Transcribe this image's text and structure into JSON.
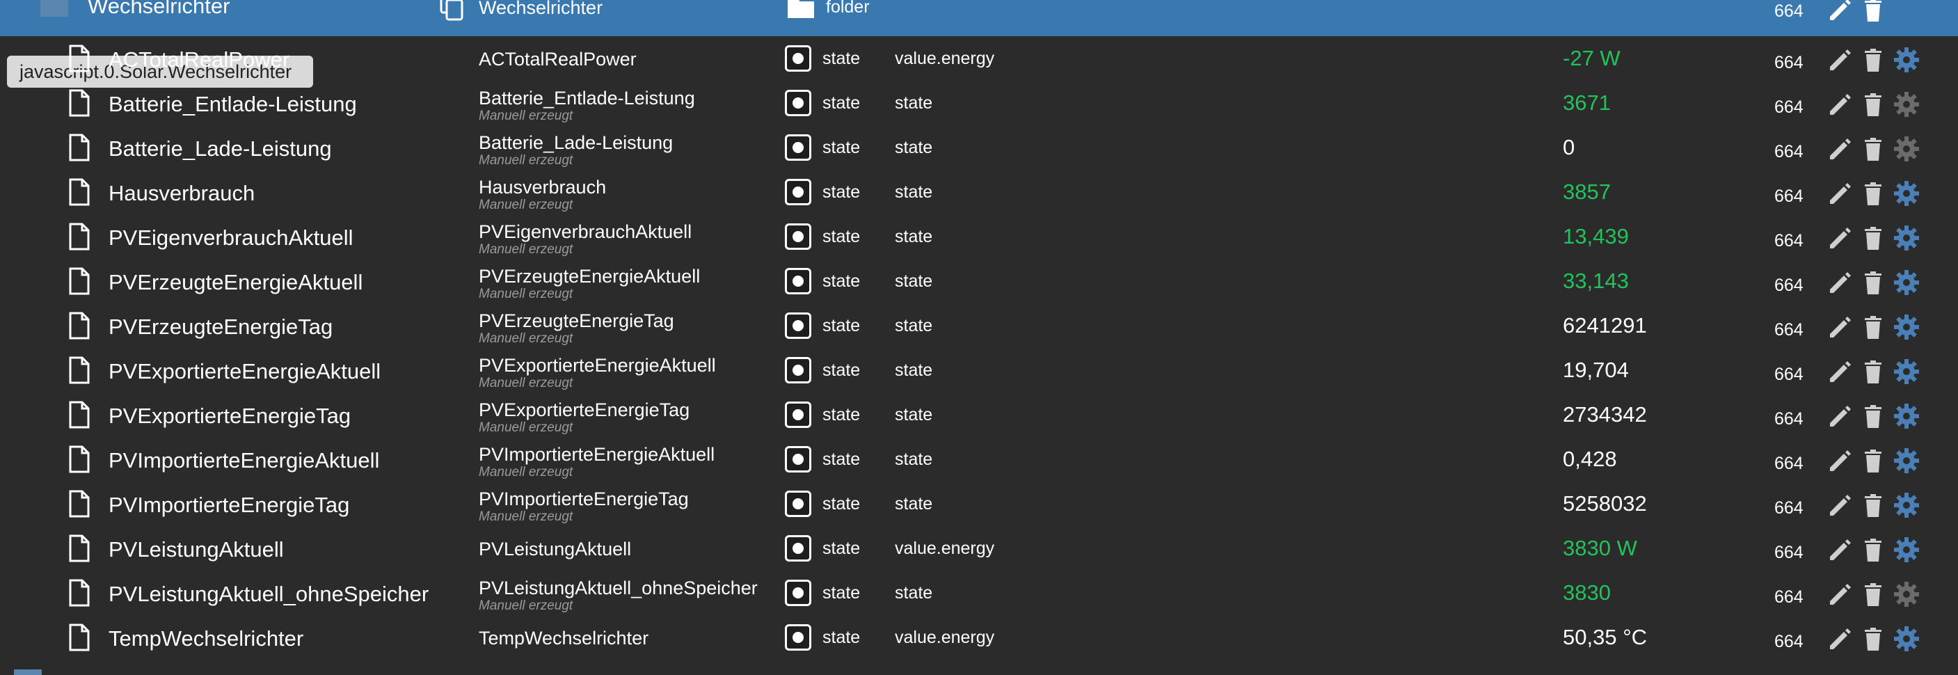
{
  "header": {
    "name": "Wechselrichter",
    "id": "Wechselrichter",
    "type": "folder",
    "acl": "664"
  },
  "tooltip": "javascript.0.Solar.Wechselrichter",
  "rows": [
    {
      "name": "ACTotalRealPower",
      "id": "ACTotalRealPower",
      "sub": "",
      "type": "state",
      "role": "value.energy",
      "value": "-27 W",
      "acl": "664"
    },
    {
      "name": "Batterie_Entlade-Leistung",
      "id": "Batterie_Entlade-Leistung",
      "sub": "Manuell erzeugt",
      "type": "state",
      "role": "state",
      "value": "3671",
      "acl": "664"
    },
    {
      "name": "Batterie_Lade-Leistung",
      "id": "Batterie_Lade-Leistung",
      "sub": "Manuell erzeugt",
      "type": "state",
      "role": "state",
      "value": "0",
      "acl": "664"
    },
    {
      "name": "Hausverbrauch",
      "id": "Hausverbrauch",
      "sub": "Manuell erzeugt",
      "type": "state",
      "role": "state",
      "value": "3857",
      "acl": "664"
    },
    {
      "name": "PVEigenverbrauchAktuell",
      "id": "PVEigenverbrauchAktuell",
      "sub": "Manuell erzeugt",
      "type": "state",
      "role": "state",
      "value": "13,439",
      "acl": "664"
    },
    {
      "name": "PVErzeugteEnergieAktuell",
      "id": "PVErzeugteEnergieAktuell",
      "sub": "Manuell erzeugt",
      "type": "state",
      "role": "state",
      "value": "33,143",
      "acl": "664"
    },
    {
      "name": "PVErzeugteEnergieTag",
      "id": "PVErzeugteEnergieTag",
      "sub": "Manuell erzeugt",
      "type": "state",
      "role": "state",
      "value": "6241291",
      "acl": "664"
    },
    {
      "name": "PVExportierteEnergieAktuell",
      "id": "PVExportierteEnergieAktuell",
      "sub": "Manuell erzeugt",
      "type": "state",
      "role": "state",
      "value": "19,704",
      "acl": "664"
    },
    {
      "name": "PVExportierteEnergieTag",
      "id": "PVExportierteEnergieTag",
      "sub": "Manuell erzeugt",
      "type": "state",
      "role": "state",
      "value": "2734342",
      "acl": "664"
    },
    {
      "name": "PVImportierteEnergieAktuell",
      "id": "PVImportierteEnergieAktuell",
      "sub": "Manuell erzeugt",
      "type": "state",
      "role": "state",
      "value": "0,428",
      "acl": "664"
    },
    {
      "name": "PVImportierteEnergieTag",
      "id": "PVImportierteEnergieTag",
      "sub": "Manuell erzeugt",
      "type": "state",
      "role": "state",
      "value": "5258032",
      "acl": "664"
    },
    {
      "name": "PVLeistungAktuell",
      "id": "PVLeistungAktuell",
      "sub": "",
      "type": "state",
      "role": "value.energy",
      "value": "3830 W",
      "acl": "664"
    },
    {
      "name": "PVLeistungAktuell_ohneSpeicher",
      "id": "PVLeistungAktuell_ohneSpeicher",
      "sub": "Manuell erzeugt",
      "type": "state",
      "role": "state",
      "value": "3830",
      "acl": "664"
    },
    {
      "name": "TempWechselrichter",
      "id": "TempWechselrichter",
      "sub": "",
      "type": "state",
      "role": "value.energy",
      "value": "50,35 °C",
      "acl": "664"
    }
  ],
  "colors": {
    "header_bg": "#3a78b0",
    "body_bg": "#2b2b2b",
    "value_green": "#22c35b",
    "gear_blue": "#4a7fb8",
    "gear_gray": "#6b6b6b"
  }
}
